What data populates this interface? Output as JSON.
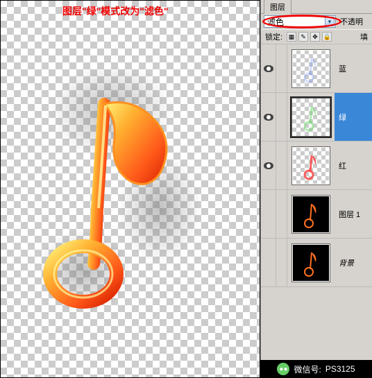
{
  "instruction_text": "图层\"绿\"模式改为\"滤色\"",
  "panel": {
    "tab_label": "图层",
    "blend_mode": "滤色",
    "opacity_label": "不透明",
    "lock_label": "锁定:",
    "fill_label": "填"
  },
  "layers": [
    {
      "name": "蓝",
      "visible": true,
      "selected": false,
      "thumb_type": "blue"
    },
    {
      "name": "绿",
      "visible": true,
      "selected": true,
      "thumb_type": "green"
    },
    {
      "name": "红",
      "visible": true,
      "selected": false,
      "thumb_type": "red"
    },
    {
      "name": "图层 1",
      "visible": false,
      "selected": false,
      "thumb_type": "fire_black"
    },
    {
      "name": "背景",
      "visible": false,
      "selected": false,
      "thumb_type": "fire_black"
    }
  ],
  "footer": {
    "label": "微信号:",
    "value": "PS3125"
  },
  "colors": {
    "instruction": "#e00",
    "selection": "#3a87d8"
  }
}
